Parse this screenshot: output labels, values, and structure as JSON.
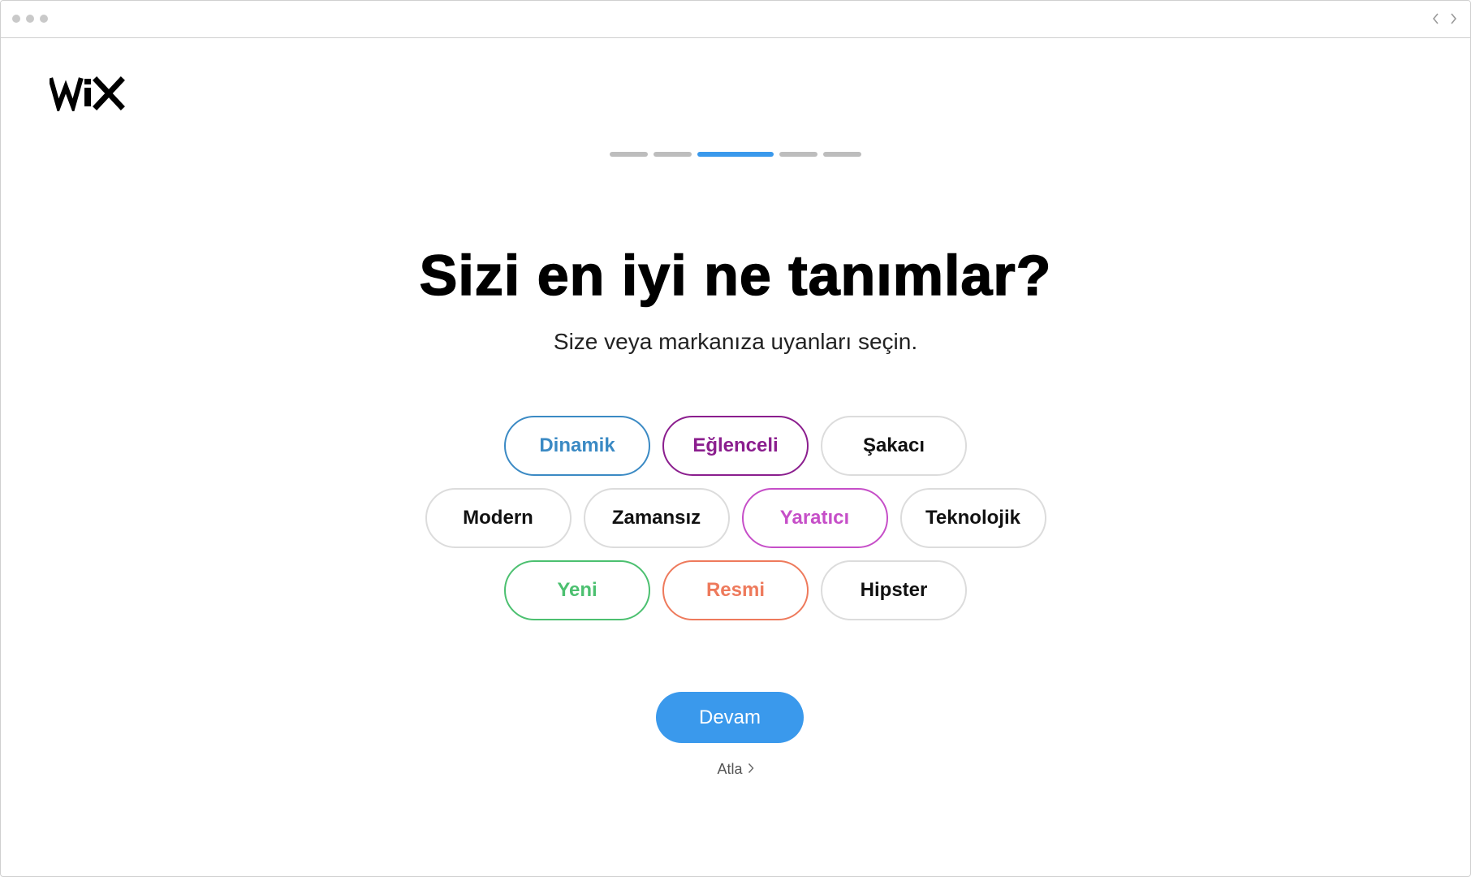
{
  "window": {
    "nav_icons": [
      "chevron-left-icon",
      "chevron-right-icon"
    ]
  },
  "brand": {
    "logo_text": "WiX"
  },
  "progress": {
    "total_steps": 5,
    "current_step": 3
  },
  "heading": {
    "title": "Sizi en iyi ne tanımlar?",
    "subtitle": "Size veya markanıza uyanları seçin."
  },
  "options": {
    "rows": [
      [
        {
          "label": "Dinamik",
          "selected": true,
          "color": "#3b8ac4"
        },
        {
          "label": "Eğlenceli",
          "selected": true,
          "color": "#8b1e8e"
        },
        {
          "label": "Şakacı",
          "selected": false,
          "color": "#111111"
        }
      ],
      [
        {
          "label": "Modern",
          "selected": false,
          "color": "#111111"
        },
        {
          "label": "Zamansız",
          "selected": false,
          "color": "#111111"
        },
        {
          "label": "Yaratıcı",
          "selected": true,
          "color": "#c64fc8"
        },
        {
          "label": "Teknolojik",
          "selected": false,
          "color": "#111111"
        }
      ],
      [
        {
          "label": "Yeni",
          "selected": true,
          "color": "#4cc070"
        },
        {
          "label": "Resmi",
          "selected": true,
          "color": "#ee7a5c"
        },
        {
          "label": "Hipster",
          "selected": false,
          "color": "#111111"
        }
      ]
    ]
  },
  "actions": {
    "continue_label": "Devam",
    "skip_label": "Atla"
  },
  "colors": {
    "accent": "#3a99ec",
    "progress_inactive": "#bdbdbd",
    "chip_border": "#dcdcdc"
  }
}
